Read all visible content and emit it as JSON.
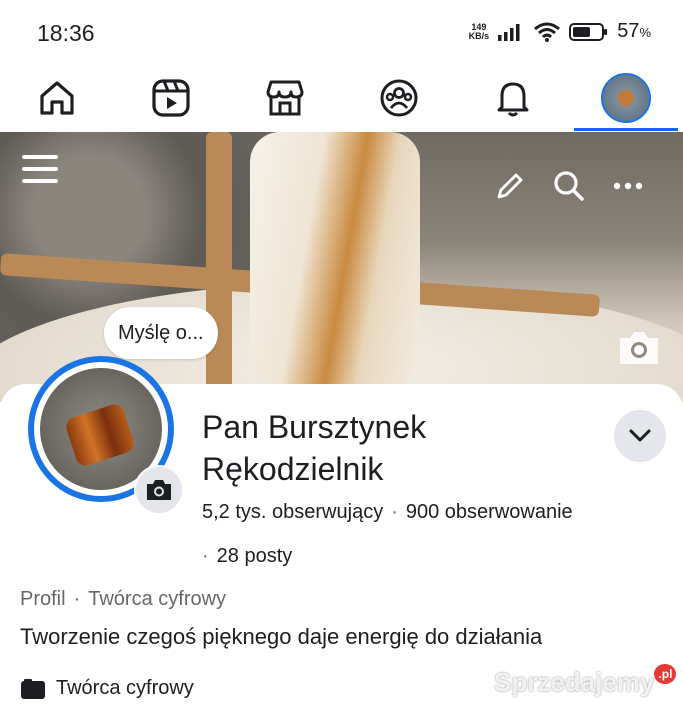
{
  "status_bar": {
    "time": "18:36",
    "net_speed_value": "149",
    "net_speed_unit": "KB/s",
    "battery": "57",
    "battery_unit": "%"
  },
  "nav": {
    "tabs": [
      "home-icon",
      "reels-icon",
      "marketplace-icon",
      "groups-icon",
      "notifications-icon",
      "profile-avatar"
    ]
  },
  "cover": {
    "thought_bubble": "Myślę o..."
  },
  "profile": {
    "name_line1": "Pan Bursztynek",
    "name_line2": "Rękodzielnik",
    "followers": "5,2 tys. obserwujący",
    "following": "900 obserwowanie",
    "posts": "28 posty",
    "category_label": "Profil",
    "category_value": "Twórca cyfrowy",
    "bio": "Tworzenie czegoś pięknego daje energię do działania",
    "creator_label": "Twórca cyfrowy"
  },
  "watermark": {
    "text": "Sprzedajemy",
    "suffix": ".pl"
  },
  "colors": {
    "accent": "#0866ff",
    "ring": "#1b74e4",
    "secondary_text": "#65676b",
    "chip_bg": "#e4e6eb"
  }
}
